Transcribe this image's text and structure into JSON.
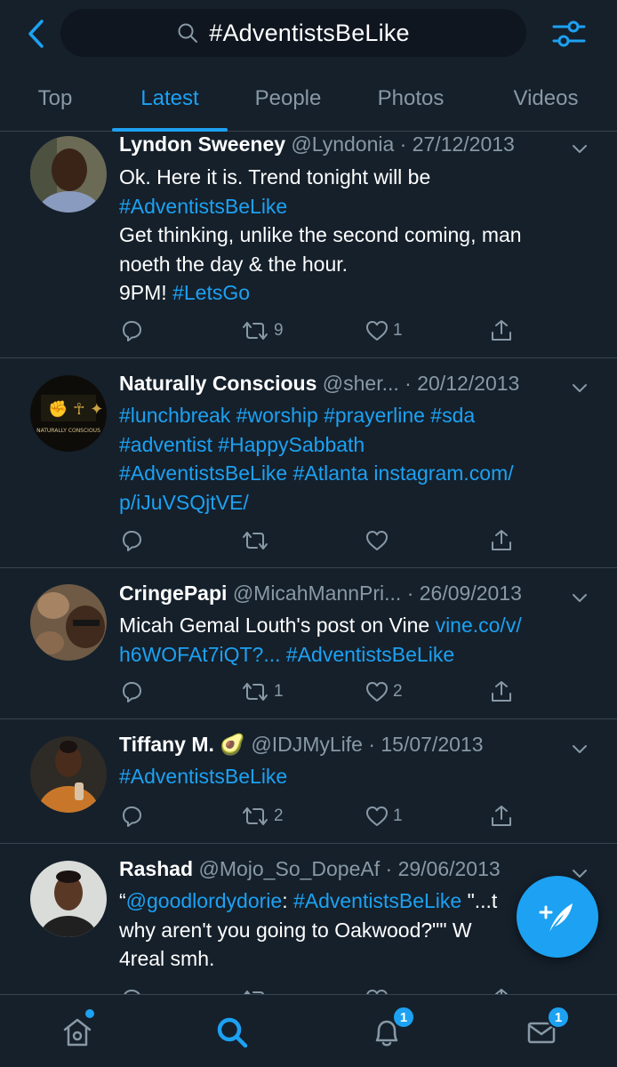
{
  "search": {
    "query": "#AdventistsBeLike"
  },
  "tabs": [
    {
      "label": "Top"
    },
    {
      "label": "Latest"
    },
    {
      "label": "People"
    },
    {
      "label": "Photos"
    },
    {
      "label": "Videos"
    }
  ],
  "active_tab": "Latest",
  "tweets": [
    {
      "name": "Lyndon Sweeney",
      "handle": "@Lyndonia",
      "date": "· 27/12/2013",
      "lines": [
        "Ok. Here it is. Trend tonight will be",
        "#AdventistsBeLike",
        "Get thinking, unlike the second coming, man",
        "noeth the day & the hour.",
        "9PM! ",
        "#LetsGo"
      ],
      "retweets": "9",
      "likes": "1"
    },
    {
      "name": "Naturally Conscious",
      "handle": "@sher...",
      "date": "· 20/12/2013",
      "lines": [
        "#lunchbreak #worship #prayerline #sda",
        "#adventist #HappySabbath",
        "#AdventistsBeLike",
        " #Atlanta instagram.com/",
        "p/iJuVSQjtVE/"
      ],
      "avatar_text": "NATURALLY CONSCIOUS",
      "retweets": "",
      "likes": ""
    },
    {
      "name": "CringePapi",
      "handle": "@MicahMannPri...",
      "date": "· 26/09/2013",
      "lines": [
        "Micah Gemal Louth's post on Vine ",
        "vine.co/v/",
        "h6WOFAt7iQT?... ",
        "#AdventistsBeLike"
      ],
      "retweets": "1",
      "likes": "2"
    },
    {
      "name": "Tiffany M. 🥑",
      "handle": "@IDJMyLife",
      "date": "· 15/07/2013",
      "lines": [
        "#AdventistsBeLike"
      ],
      "retweets": "2",
      "likes": "1"
    },
    {
      "name": "Rashad",
      "handle": "@Mojo_So_DopeAf",
      "date": "· 29/06/2013",
      "lines": [
        "“",
        "@goodlordydorie",
        ": ",
        "#AdventistsBeLike",
        " \"...t",
        "why aren't you going to Oakwood?\"\" W",
        "4real smh."
      ]
    }
  ],
  "nav": {
    "notifications_badge": "1",
    "messages_badge": "1"
  },
  "colors": {
    "background": "#15202b",
    "accent": "#1da1f2",
    "muted": "#8899a6",
    "divider": "#38444d"
  }
}
